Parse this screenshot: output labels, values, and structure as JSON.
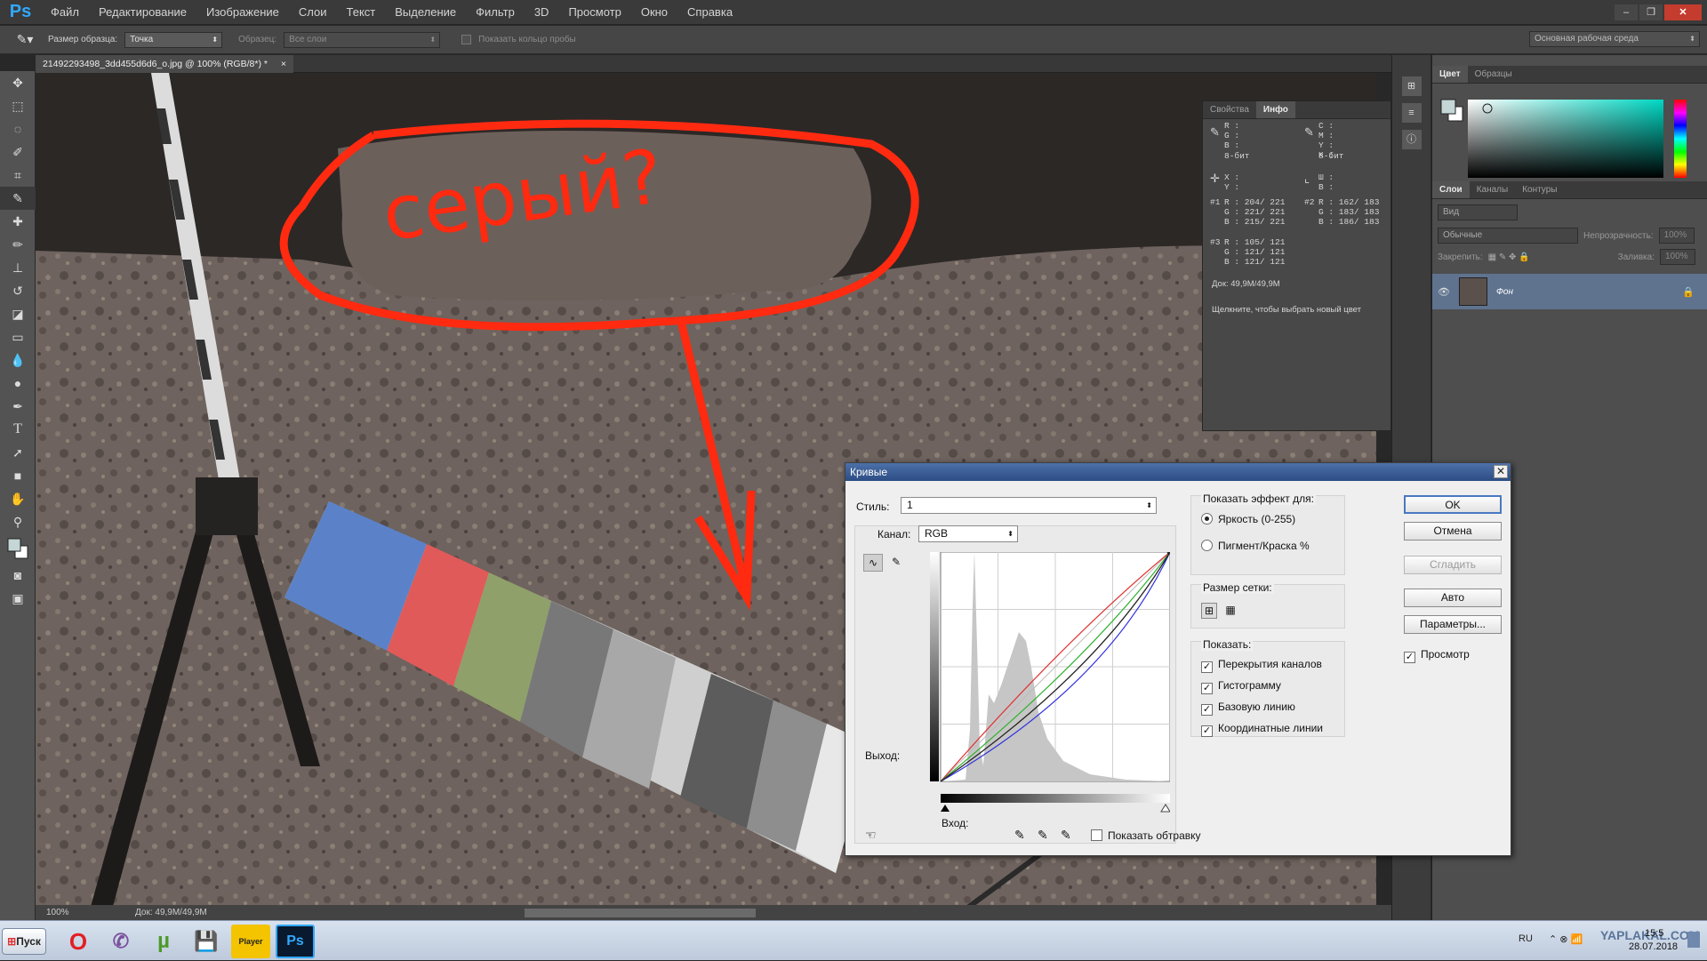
{
  "app": {
    "logo": "Ps"
  },
  "menu": [
    "Файл",
    "Редактирование",
    "Изображение",
    "Слои",
    "Текст",
    "Выделение",
    "Фильтр",
    "3D",
    "Просмотр",
    "Окно",
    "Справка"
  ],
  "window_controls": [
    "–",
    "❐",
    "✕"
  ],
  "options": {
    "sample_size_label": "Размер образца:",
    "sample_size_value": "Точка",
    "sample_label": "Образец:",
    "sample_value": "Все слои",
    "show_ring_label": "Показать кольцо пробы",
    "workspace": "Основная рабочая среда"
  },
  "document": {
    "tab_title": "21492293498_3dd455d6d6_o.jpg @ 100% (RGB/8*) *",
    "tab_close": "×",
    "annotation_text": "серый?"
  },
  "status": {
    "zoom": "100%",
    "doc": "Док: 49,9M/49,9M"
  },
  "info_panel": {
    "tabs": [
      "Свойства",
      "Инфо"
    ],
    "rgb_block": "R :\nG :\nB :",
    "cmyk_block": "C :\nM :\nY :\nK :",
    "bit_left": "8-бит",
    "bit_right": "8-бит",
    "xy_block": "X :\nY :",
    "wh_block": "Ш :\nВ :",
    "s1_label": "#1",
    "s1": "R : 204/ 221\nG : 221/ 221\nB : 215/ 221",
    "s2_label": "#2",
    "s2": "R : 162/ 183\nG : 183/ 183\nB : 186/ 183",
    "s3_label": "#3",
    "s3": "R : 105/ 121\nG : 121/ 121\nB : 121/ 121",
    "doc": "Док: 49,9M/49,9M",
    "hint": "Щелкните, чтобы выбрать новый цвет"
  },
  "color_panel": {
    "tabs": [
      "Цвет",
      "Образцы"
    ]
  },
  "layers_panel": {
    "tabs": [
      "Слои",
      "Каналы",
      "Контуры"
    ],
    "kind_filter": "Вид",
    "blend_mode": "Обычные",
    "opacity_label": "Непрозрачность:",
    "opacity_value": "100%",
    "lock_label": "Закрепить:",
    "fill_label": "Заливка:",
    "fill_value": "100%",
    "layer_name": "Фон"
  },
  "curves": {
    "title": "Кривые",
    "close": "✕",
    "style_label": "Стиль:",
    "style_value": "1",
    "channel_label": "Канал:",
    "channel_value": "RGB",
    "output_label": "Выход:",
    "input_label": "Вход:",
    "show_clipping": "Показать обтравку",
    "show_effect_title": "Показать эффект для:",
    "light_option": "Яркость (0-255)",
    "pigment_option": "Пигмент/Краска %",
    "grid_size_title": "Размер сетки:",
    "show_title": "Показать:",
    "show_options": [
      "Перекрытия каналов",
      "Гистограмму",
      "Базовую линию",
      "Координатные линии"
    ],
    "buttons": {
      "ok": "OK",
      "cancel": "Отмена",
      "smooth": "Сгладить",
      "auto": "Авто",
      "params": "Параметры..."
    },
    "preview": "Просмотр",
    "check": "✓"
  },
  "taskbar": {
    "start": "Пуск",
    "lang": "RU",
    "time": "15:5",
    "date": "28.07.2018",
    "watermark": "YAPLAKAL.COM",
    "potplayer": "Player"
  }
}
